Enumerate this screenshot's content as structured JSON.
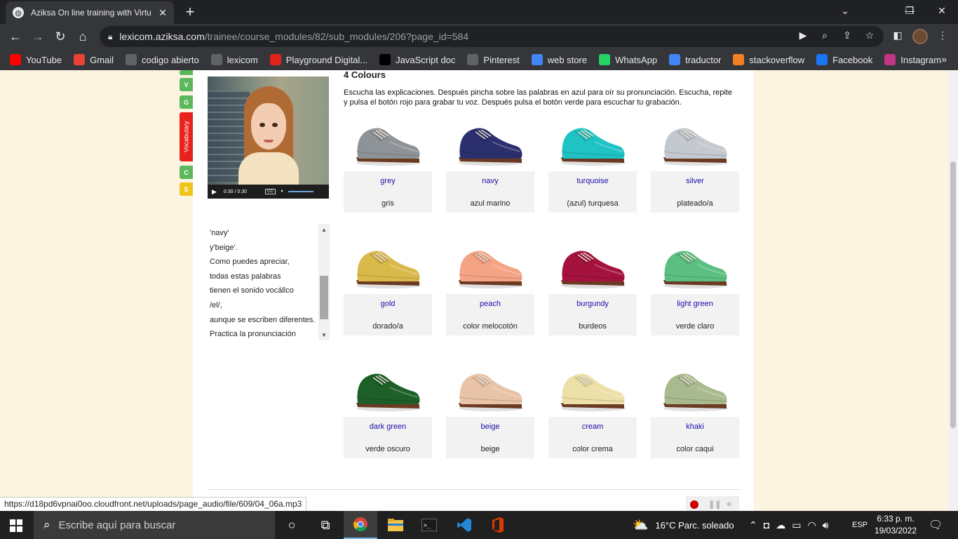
{
  "browser": {
    "tab_title": "Aziksa On line training with Virtu",
    "new_tab": "+",
    "url_host": "lexicom.aziksa.com",
    "url_path": "/trainee/course_modules/82/sub_modules/206?page_id=584",
    "bookmarks": [
      {
        "label": "YouTube",
        "icon": "youtube-icon",
        "color": "#ff0000"
      },
      {
        "label": "Gmail",
        "icon": "gmail-icon",
        "color": "#ea4335"
      },
      {
        "label": "codigo abierto",
        "icon": "page-icon",
        "color": "#5f6368"
      },
      {
        "label": "lexicom",
        "icon": "globe-icon",
        "color": "#5f6368"
      },
      {
        "label": "Playground Digital...",
        "icon": "playground-icon",
        "color": "#e2231a"
      },
      {
        "label": "JavaScript doc",
        "icon": "mdn-icon",
        "color": "#000000"
      },
      {
        "label": "Pinterest",
        "icon": "globe-icon",
        "color": "#5f6368"
      },
      {
        "label": "web store",
        "icon": "webstore-icon",
        "color": "#4285f4"
      },
      {
        "label": "WhatsApp",
        "icon": "whatsapp-icon",
        "color": "#25d366"
      },
      {
        "label": "traductor",
        "icon": "google-icon",
        "color": "#4285f4"
      },
      {
        "label": "stackoverflow",
        "icon": "stackoverflow-icon",
        "color": "#f48024"
      },
      {
        "label": "Facebook",
        "icon": "facebook-icon",
        "color": "#1877f2"
      },
      {
        "label": "Instagram",
        "icon": "instagram-icon",
        "color": "#c13584"
      }
    ],
    "bookmarks_more": "»"
  },
  "sidebar_tabs": [
    {
      "label": "",
      "color": "#5cb85c"
    },
    {
      "label": "V",
      "color": "#5cb85c"
    },
    {
      "label": "G",
      "color": "#5cb85c"
    },
    {
      "label": "Vocabulary",
      "color": "#e8211c"
    },
    {
      "label": "C",
      "color": "#5cb85c"
    },
    {
      "label": "S",
      "color": "#f0c419"
    }
  ],
  "video": {
    "time": "0:30 / 0:30",
    "cc": "CC"
  },
  "transcript": {
    "lines": [
      "'navy'",
      "y'beige'.",
      "Como puedes apreciar,",
      "todas estas palabras",
      "tienen el sonido vocállco",
      "/el/,",
      "aunque se escriben diferentes.",
      "Practica la pronunciación"
    ]
  },
  "lesson": {
    "heading": "4 Colours",
    "instructions": "Escucha las explicaciones. Después pincha sobre las palabras en azul para oír su pronunciación. Escucha, repite y pulsa el botón rojo para grabar tu voz. Después pulsa el botón verde para escuchar tu grabación.",
    "colours": [
      {
        "en": "grey",
        "es": "gris",
        "color": "#8e9398"
      },
      {
        "en": "navy",
        "es": "azul marino",
        "color": "#2b2f6e"
      },
      {
        "en": "turquoise",
        "es": "(azul) turquesa",
        "color": "#1fc3c4"
      },
      {
        "en": "silver",
        "es": "plateado/a",
        "color": "#c4c8cf"
      },
      {
        "en": "gold",
        "es": "dorado/a",
        "color": "#d9b94a"
      },
      {
        "en": "peach",
        "es": "color melocotón",
        "color": "#f4a384"
      },
      {
        "en": "burgundy",
        "es": "burdeos",
        "color": "#a4123d"
      },
      {
        "en": "light green",
        "es": "verde claro",
        "color": "#5cbf82"
      },
      {
        "en": "dark green",
        "es": "verde oscuro",
        "color": "#1d5f28"
      },
      {
        "en": "beige",
        "es": "beige",
        "color": "#e9c3a6"
      },
      {
        "en": "cream",
        "es": "color crema",
        "color": "#ece0a8"
      },
      {
        "en": "khaki",
        "es": "color caqui",
        "color": "#a9bb8e"
      }
    ]
  },
  "status_url": "https://d18pd6vpnai0oo.cloudfront.net/uploads/page_audio/file/609/04_06a.mp3",
  "taskbar": {
    "search_placeholder": "Escribe aquí para buscar",
    "weather": "16°C  Parc. soleado",
    "language": "ESP",
    "time": "6:33 p. m.",
    "date": "19/03/2022"
  }
}
